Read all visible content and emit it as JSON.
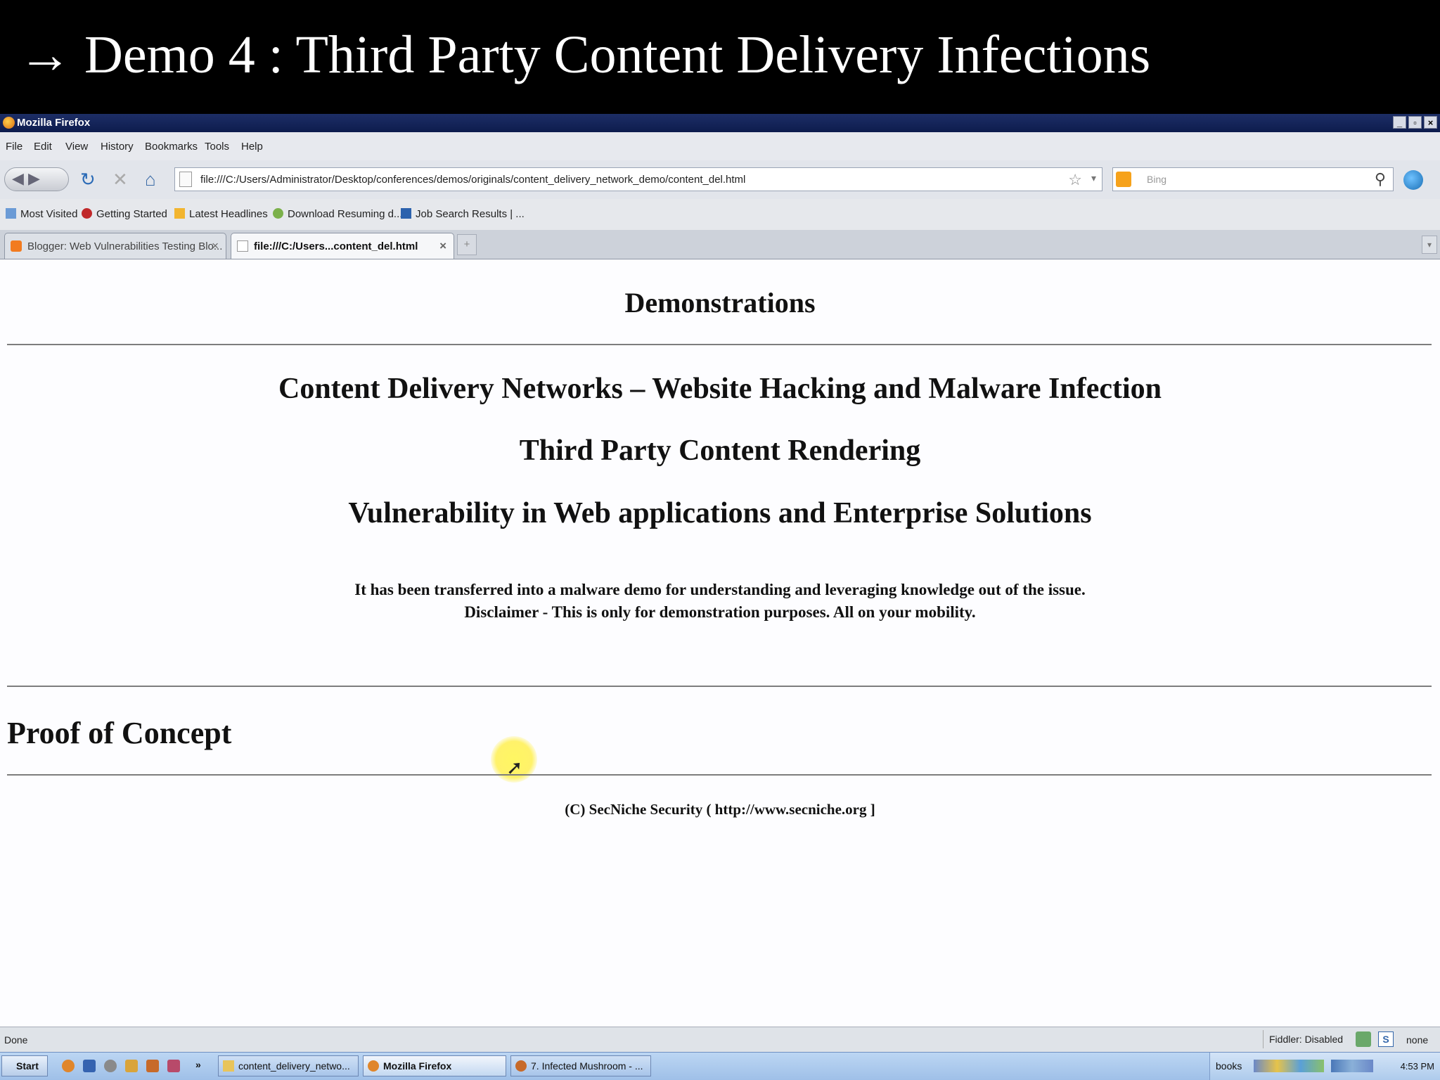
{
  "slide": {
    "arrow": "→",
    "title": "Demo 4 : Third Party Content Delivery Infections"
  },
  "window": {
    "title": "Mozilla Firefox",
    "controls": [
      "_",
      "▫",
      "×"
    ]
  },
  "menu": [
    "File",
    "Edit",
    "View",
    "History",
    "Bookmarks",
    "Tools",
    "Help"
  ],
  "navbar": {
    "url": "file:///C:/Users/Administrator/Desktop/conferences/demos/originals/content_delivery_network_demo/content_del.html",
    "search_placeholder": "Bing"
  },
  "bookmarks": [
    "Most Visited",
    "Getting Started",
    "Latest Headlines",
    "Download Resuming d...",
    "Job Search Results | ..."
  ],
  "tabs": [
    {
      "label": "Blogger: Web Vulnerabilities Testing Blo...",
      "active": false
    },
    {
      "label": "file:///C:/Users...content_del.html",
      "active": true
    }
  ],
  "page": {
    "heading": "Demonstrations",
    "title1": "Content Delivery Networks – Website Hacking and Malware Infection",
    "title2": "Third Party Content Rendering",
    "title3": "Vulnerability in Web applications and Enterprise Solutions",
    "line1": "It has been transferred into a malware demo for understanding and leveraging knowledge out of the issue.",
    "line2": "Disclaimer - This is only for demonstration purposes. All on your mobility.",
    "poc": "Proof of Concept",
    "footer": "(C) SecNiche Security ( http://www.secniche.org ]"
  },
  "status": {
    "text": "Done",
    "fiddler": "Fiddler: Disabled",
    "right": "none"
  },
  "taskbar": {
    "start": "Start",
    "more": "»",
    "tasks": [
      "content_delivery_netwo...",
      "Mozilla Firefox",
      "7. Infected Mushroom - ..."
    ],
    "tray_label": "books",
    "clock": "4:53 PM"
  }
}
